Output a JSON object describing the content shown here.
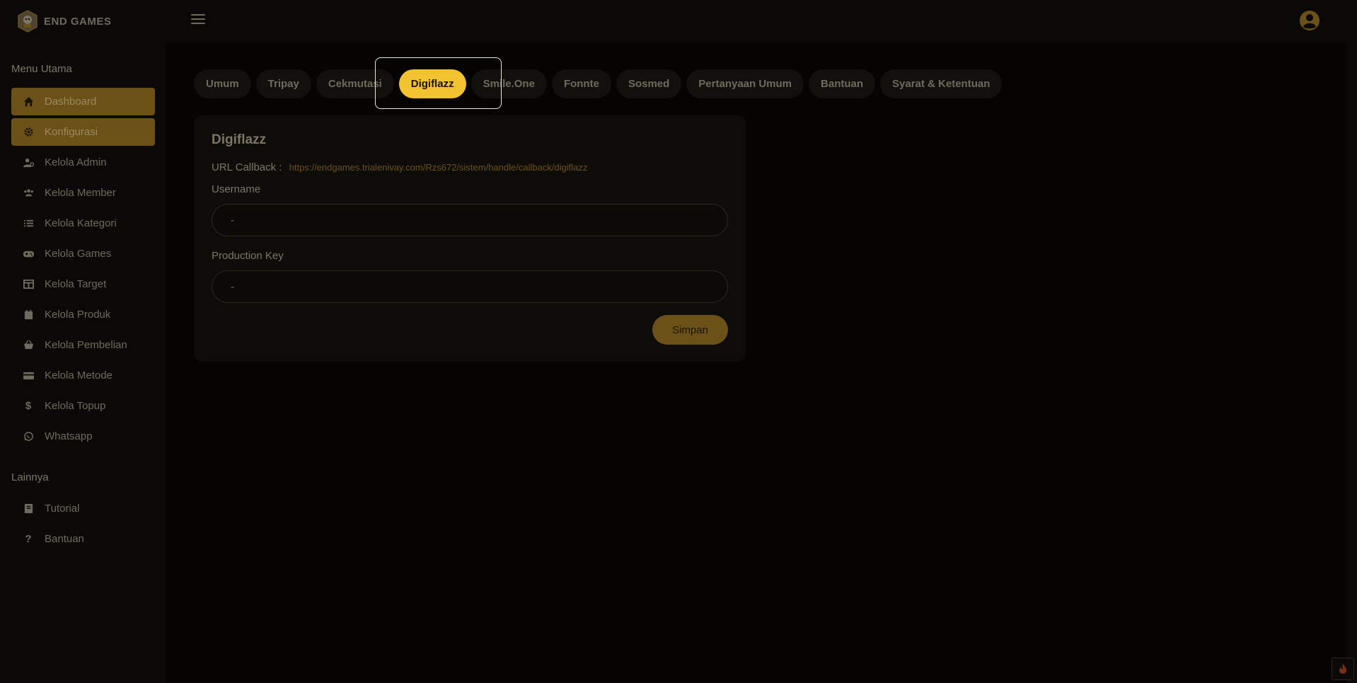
{
  "brand": {
    "name": "END GAMES"
  },
  "sidebar": {
    "main_title": "Menu Utama",
    "items": [
      {
        "label": "Dashboard",
        "icon": "home-icon"
      },
      {
        "label": "Konfigurasi",
        "icon": "gear-icon"
      },
      {
        "label": "Kelola Admin",
        "icon": "user-gear-icon"
      },
      {
        "label": "Kelola Member",
        "icon": "users-icon"
      },
      {
        "label": "Kelola Kategori",
        "icon": "list-icon"
      },
      {
        "label": "Kelola Games",
        "icon": "gamepad-icon"
      },
      {
        "label": "Kelola Target",
        "icon": "table-icon"
      },
      {
        "label": "Kelola Produk",
        "icon": "calendar-icon"
      },
      {
        "label": "Kelola Pembelian",
        "icon": "basket-icon"
      },
      {
        "label": "Kelola Metode",
        "icon": "card-icon"
      },
      {
        "label": "Kelola Topup",
        "icon": "dollar-icon"
      },
      {
        "label": "Whatsapp",
        "icon": "whatsapp-icon"
      }
    ],
    "other_title": "Lainnya",
    "other_items": [
      {
        "label": "Tutorial",
        "icon": "book-icon"
      },
      {
        "label": "Bantuan",
        "icon": "question-icon"
      }
    ]
  },
  "tabs": [
    {
      "label": "Umum"
    },
    {
      "label": "Tripay"
    },
    {
      "label": "Cekmutasi"
    },
    {
      "label": "Digiflazz"
    },
    {
      "label": "Smile.One"
    },
    {
      "label": "Fonnte"
    },
    {
      "label": "Sosmed"
    },
    {
      "label": "Pertanyaan Umum"
    },
    {
      "label": "Bantuan"
    },
    {
      "label": "Syarat & Ketentuan"
    }
  ],
  "card": {
    "title": "Digiflazz",
    "callback_label": "URL Callback :",
    "callback_url": "https://endgames.trialenivay.com/Rzs672/sistem/handle/callback/digiflazz",
    "username_label": "Username",
    "username_value": "-",
    "key_label": "Production Key",
    "key_value": "-",
    "save_label": "Simpan"
  },
  "colors": {
    "accent": "#f2c230",
    "active_nav": "#6b5118",
    "background": "#050403"
  }
}
